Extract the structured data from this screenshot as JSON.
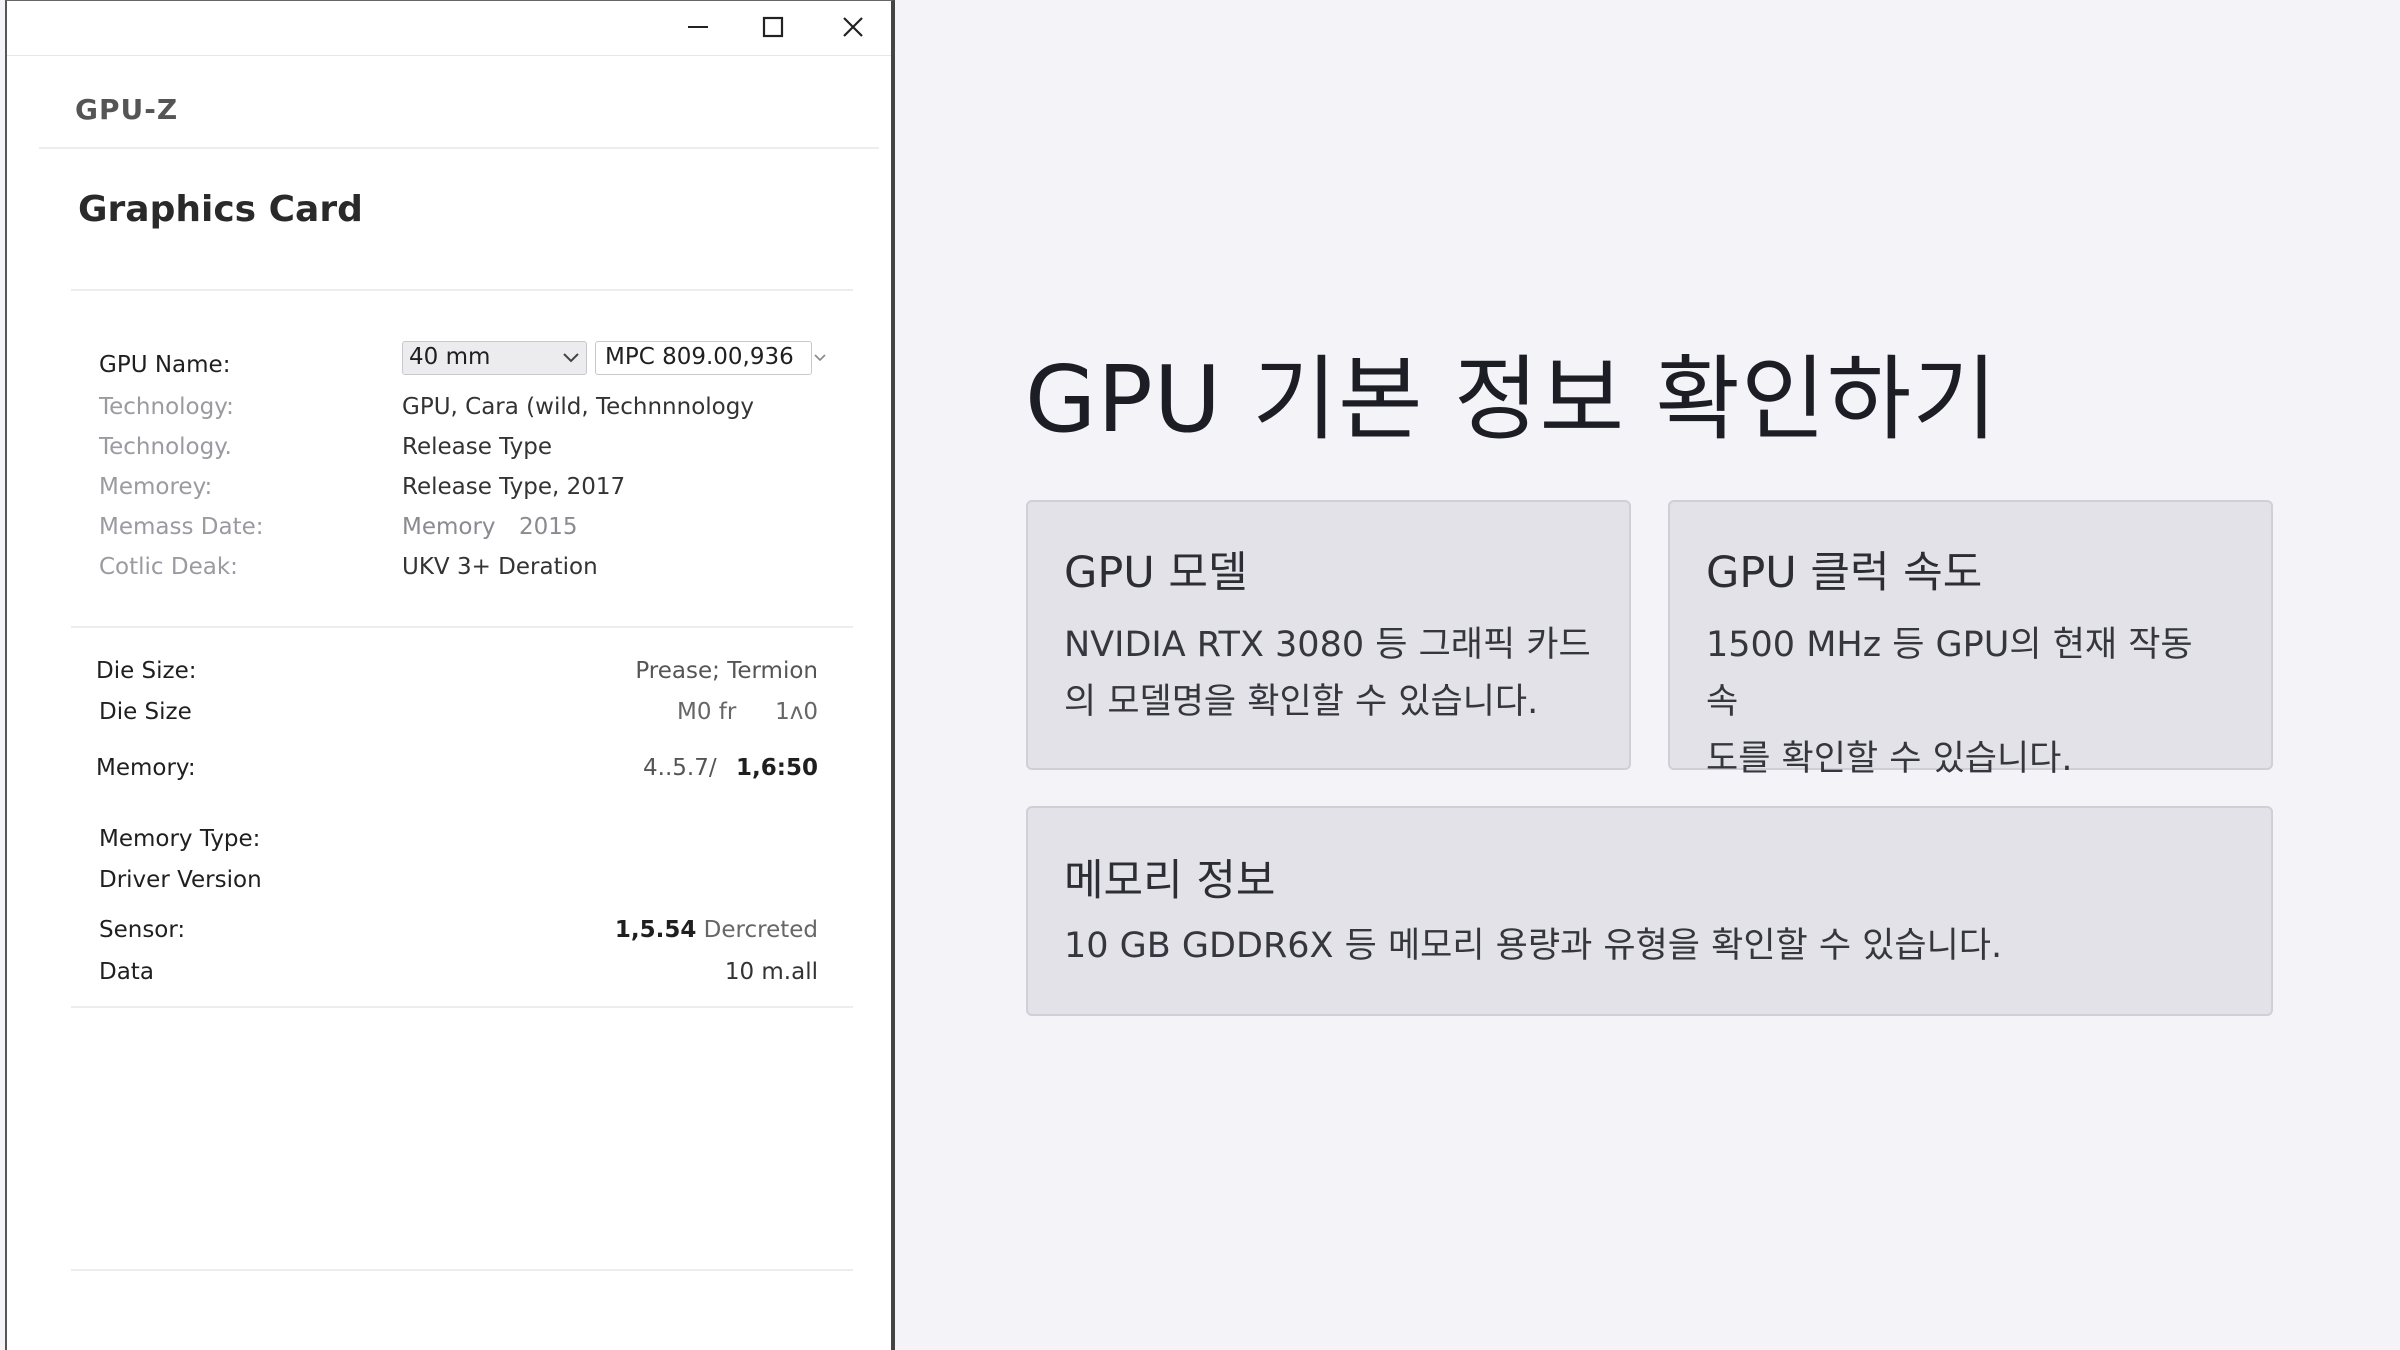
{
  "window": {
    "app_name": "GPU-Z",
    "section_title": "Graphics Card",
    "controls": {
      "minimize_icon": "minimize-icon",
      "maximize_icon": "maximize-icon",
      "close_icon": "close-icon"
    }
  },
  "gpu_name": {
    "label": "GPU Name:",
    "select_1": "40 mm",
    "select_2": "MPC 809.00,936"
  },
  "info_rows": [
    {
      "label": "Technology:",
      "value": "GPU, Cara (wild, Technnnology"
    },
    {
      "label": "Technology.",
      "value": "Release Type"
    },
    {
      "label": "Memorey:",
      "value": "Release Type, 2017"
    },
    {
      "label": "Memass Date:",
      "value_a": "Memory",
      "value_b": "2015"
    },
    {
      "label": "Cotlic Deak:",
      "value": "UKV 3+ Deration"
    }
  ],
  "spec_rows": [
    {
      "label": "Die Size:",
      "value": "Prease; Termion"
    },
    {
      "label": "Die Size",
      "value_a": "M0 fr",
      "value_b": "1ʌ0"
    },
    {
      "label": "Memory:",
      "value_a": "4..5.7/",
      "value_b": "1,6:50"
    }
  ],
  "extra_rows": [
    {
      "label": "Memory Type:"
    },
    {
      "label": "Driver Version"
    },
    {
      "label": "Sensor:",
      "value_a": "1,5.54",
      "value_b": "Dercreted"
    },
    {
      "label": "Data",
      "value": "10 m.all"
    }
  ],
  "content": {
    "heading": "GPU 기본 정보 확인하기",
    "cards": [
      {
        "title": "GPU 모델",
        "line1": "NVIDIA RTX 3080 등 그래픽 카드",
        "line2": "의 모델명을 확인할 수 있습니다."
      },
      {
        "title": "GPU 클럭 속도",
        "line1": "1500 MHz 등 GPU의 현재 작동 속",
        "line2": "도를 확인할 수 있습니다."
      },
      {
        "title": "메모리 정보",
        "line1": "10 GB GDDR6X 등 메모리 용량과 유형을 확인할 수 있습니다."
      }
    ]
  }
}
